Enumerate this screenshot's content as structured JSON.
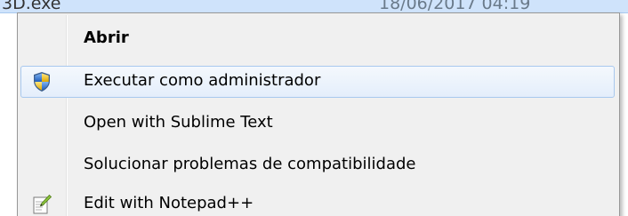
{
  "file_row": {
    "name": "3D.exe",
    "date": "18/06/2017 04:19"
  },
  "context_menu": {
    "items": [
      {
        "label": "Abrir",
        "icon": "",
        "bold": true,
        "highlighted": false
      },
      {
        "label": "Executar como administrador",
        "icon": "uac-shield-icon",
        "bold": false,
        "highlighted": true
      },
      {
        "label": "Open with Sublime Text",
        "icon": "",
        "bold": false,
        "highlighted": false
      },
      {
        "label": "Solucionar problemas de compatibilidade",
        "icon": "",
        "bold": false,
        "highlighted": false
      },
      {
        "label": "Edit with Notepad++",
        "icon": "notepad-plus-plus-icon",
        "bold": false,
        "highlighted": false
      }
    ]
  },
  "colors": {
    "highlight_border": "#a8c8ee",
    "menu_background": "#f0f0f0",
    "row_selection": "#cfe3fb"
  }
}
